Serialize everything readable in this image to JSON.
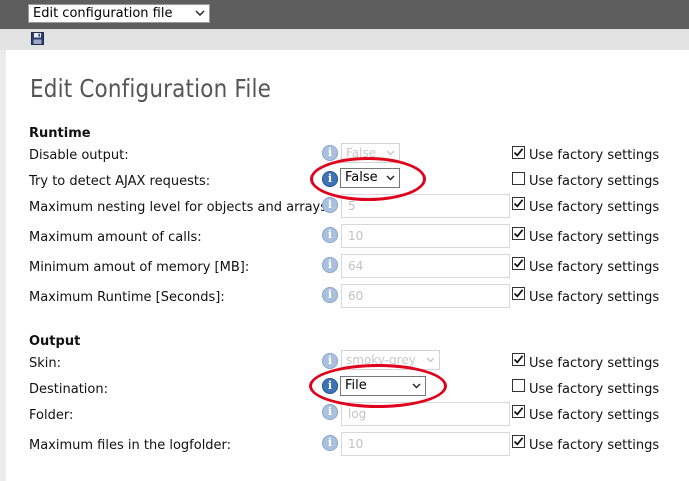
{
  "top_select": {
    "value": "Edit configuration file"
  },
  "title": "Edit Configuration File",
  "sections": {
    "runtime": {
      "title": "Runtime"
    },
    "output": {
      "title": "Output"
    }
  },
  "fields": {
    "disable_output": {
      "label": "Disable output:",
      "value": "False"
    },
    "detect_ajax": {
      "label": "Try to detect AJAX requests:",
      "value": "False"
    },
    "max_nesting": {
      "label": "Maximum nesting level for objects and arrays:",
      "value": "5"
    },
    "max_calls": {
      "label": "Maximum amount of calls:",
      "value": "10"
    },
    "min_memory": {
      "label": "Minimum amout of memory [MB]:",
      "value": "64"
    },
    "max_runtime": {
      "label": "Maximum Runtime [Seconds]:",
      "value": "60"
    },
    "skin": {
      "label": "Skin:",
      "value": "smoky-grey"
    },
    "destination": {
      "label": "Destination:",
      "value": "File"
    },
    "folder": {
      "label": "Folder:",
      "value": "log"
    },
    "max_files": {
      "label": "Maximum files in the logfolder:",
      "value": "10"
    }
  },
  "factory_label": "Use factory settings",
  "info_glyph": "i",
  "colors": {
    "highlight_ring": "#e0001b",
    "info_blue": "#3f73b8",
    "topbar": "#5e5e5e"
  }
}
